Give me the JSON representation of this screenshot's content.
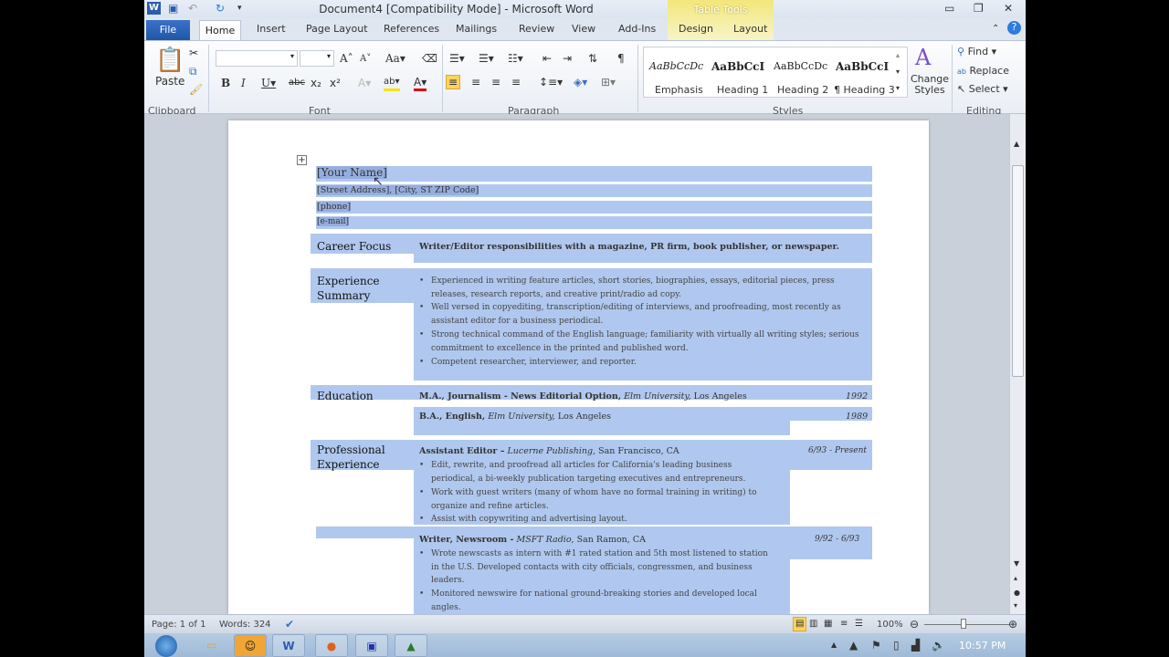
{
  "window": {
    "title": "Document4 [Compatibility Mode]  -  Microsoft Word",
    "context_tab": "Table Tools"
  },
  "tabs": [
    "File",
    "Home",
    "Insert",
    "Page Layout",
    "References",
    "Mailings",
    "Review",
    "View",
    "Add-Ins",
    "Design",
    "Layout"
  ],
  "ribbon": {
    "clipboard": {
      "label": "Clipboard",
      "paste": "Paste"
    },
    "font": {
      "label": "Font",
      "font_name": "",
      "font_size": ""
    },
    "paragraph": {
      "label": "Paragraph"
    },
    "styles": {
      "label": "Styles",
      "items": [
        {
          "preview": "AaBbCcDc",
          "name": "Emphasis"
        },
        {
          "preview": "AaBbCcI",
          "name": "Heading 1"
        },
        {
          "preview": "AaBbCcDc",
          "name": "Heading 2"
        },
        {
          "preview": "AaBbCcI",
          "name": "¶ Heading 3"
        }
      ],
      "change_styles": "Change Styles"
    },
    "editing": {
      "label": "Editing",
      "find": "Find",
      "replace": "Replace",
      "select": "Select"
    }
  },
  "document": {
    "name": "[Your Name]",
    "address": "[Street Address], [City, ST  ZIP Code]",
    "phone": "[phone]",
    "email": "[e-mail]",
    "career_focus": {
      "heading": "Career Focus",
      "text": "Writer/Editor responsibilities with a magazine, PR firm, book publisher, or newspaper."
    },
    "experience_summary": {
      "heading": "Experience Summary",
      "bullets": [
        "Experienced in writing feature articles, short stories, biographies, essays, editorial pieces, press releases, research reports, and creative print/radio ad copy.",
        "Well versed in copyediting, transcription/editing of interviews, and proofreading, most recently as assistant editor for a business periodical.",
        "Strong technical command of the English language; familiarity with virtually all writing styles; serious commitment to excellence in the printed and published word.",
        "Competent researcher, interviewer, and reporter."
      ]
    },
    "education": {
      "heading": "Education",
      "entries": [
        {
          "degree": "M.A., Journalism - News Editorial Option,",
          "school": "Elm University,",
          "place": "Los Angeles",
          "year": "1992"
        },
        {
          "degree": "B.A., English,",
          "school": "Elm University,",
          "place": "Los Angeles",
          "year": "1989"
        }
      ]
    },
    "professional": {
      "heading": "Professional Experience",
      "jobs": [
        {
          "title": "Assistant Editor –",
          "company": "Lucerne Publishing,",
          "place": "San Francisco, CA",
          "dates": "6/93 - Present",
          "bullets": [
            "Edit, rewrite, and proofread all articles for California's leading business periodical, a bi-weekly publication targeting executives and entrepreneurs.",
            "Work with guest writers (many of whom have no formal training in writing) to organize and refine articles.",
            "Assist with copywriting and advertising layout."
          ]
        },
        {
          "title": "Writer, Newsroom -",
          "company": "MSFT Radio,",
          "place": "San Ramon, CA",
          "dates": "9/92 - 6/93",
          "bullets": [
            "Wrote newscasts as intern with #1 rated station and 5th most listened to station in the U.S. Developed contacts with city officials, congressmen, and business leaders.",
            "Monitored newswire for national ground-breaking stories and developed local angles."
          ]
        }
      ]
    }
  },
  "status": {
    "page": "Page: 1 of 1",
    "words": "Words: 324",
    "zoom": "100%"
  },
  "taskbar": {
    "clock": "10:57 PM"
  },
  "colors": {
    "selection": "#b0c8ef",
    "file_tab": "#2a63b8",
    "context": "#f2e77a"
  }
}
